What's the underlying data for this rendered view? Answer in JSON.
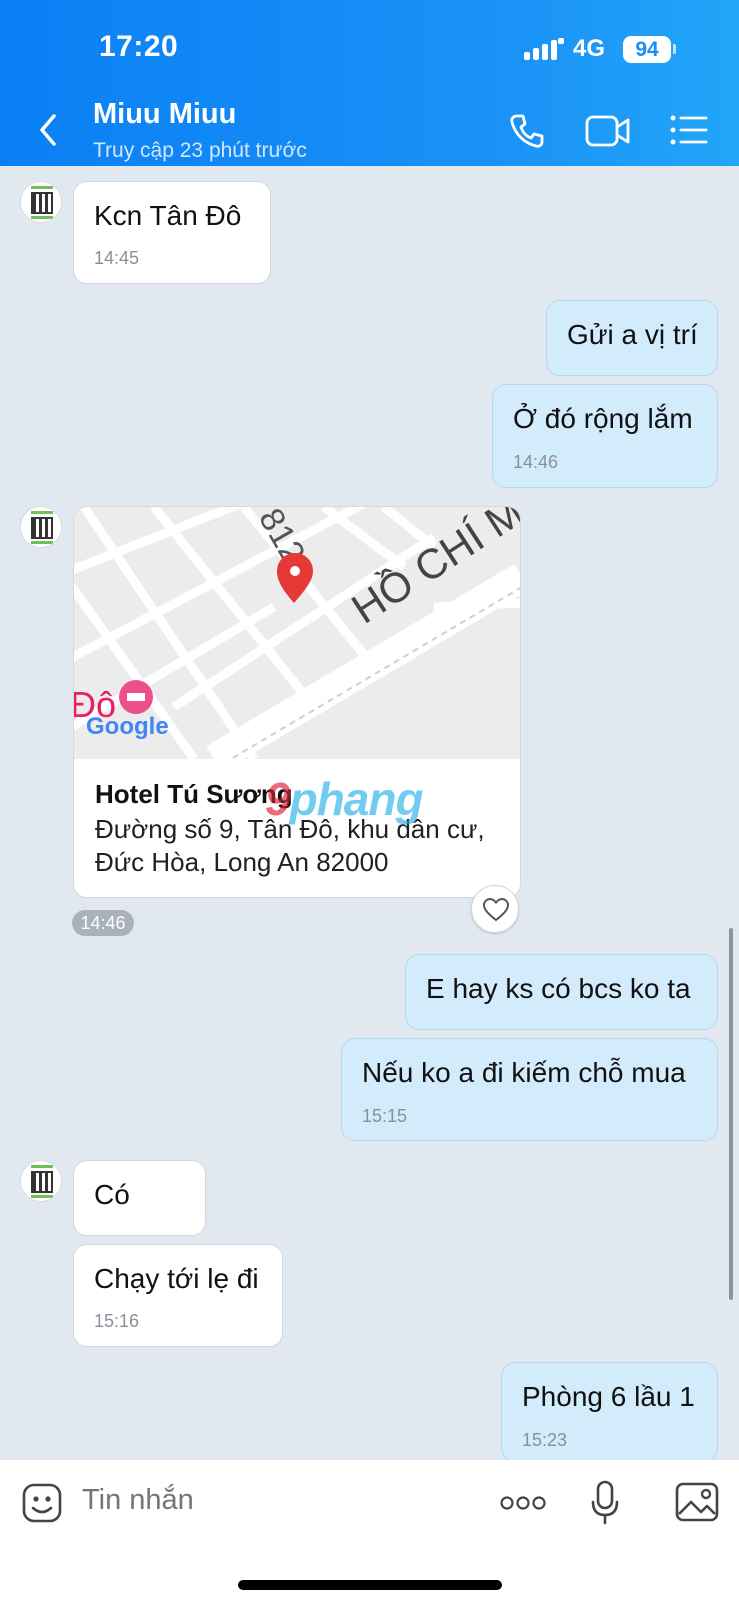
{
  "status": {
    "time": "17:20",
    "network": "4G",
    "battery": "94"
  },
  "header": {
    "name": "Miuu Miuu",
    "subtitle": "Truy cập 23 phút trước"
  },
  "messages": {
    "m1": {
      "text": "Kcn Tân Đô",
      "time": "14:45"
    },
    "m2": {
      "text": "Gửi a vị trí"
    },
    "m3": {
      "text": "Ở đó rộng lắm",
      "time": "14:46"
    },
    "m5": {
      "text": "E hay ks có bcs ko ta"
    },
    "m6": {
      "text": "Nếu ko a đi kiếm chỗ mua",
      "time": "15:15"
    },
    "m7": {
      "text": "Có"
    },
    "m8": {
      "text": "Chạy tới lẹ đi",
      "time": "15:16"
    },
    "m9": {
      "text": "Phòng 6 lầu 1",
      "time": "15:23"
    }
  },
  "location": {
    "hotel": "Hotel Tú Sương",
    "address": "Đường số 9, Tân Đô, khu dân cư, Đức Hòa, Long An 82000",
    "time": "14:46",
    "map": {
      "street_label": "HỒ CHÍ M",
      "number_label": "812",
      "place_label": "Đô",
      "google_label": "Google"
    }
  },
  "watermark": {
    "part1": "9",
    "part2": "phang"
  },
  "input": {
    "placeholder": "Tin nhắn"
  },
  "colors": {
    "header": "#0a7ff5",
    "outgoing": "#d3ecfb",
    "incoming": "#ffffff",
    "background": "#e2e8f0"
  }
}
